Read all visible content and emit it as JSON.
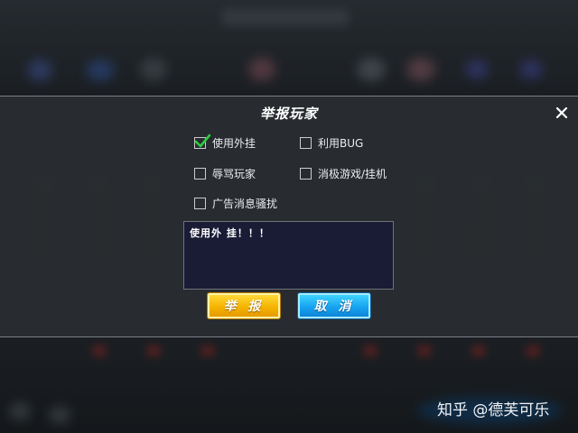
{
  "dialog": {
    "title": "举报玩家",
    "options": [
      {
        "label": "使用外挂",
        "checked": true
      },
      {
        "label": "利用BUG",
        "checked": false
      },
      {
        "label": "辱骂玩家",
        "checked": false
      },
      {
        "label": "消极游戏/挂机",
        "checked": false
      },
      {
        "label": "广告消息骚扰",
        "checked": false
      }
    ],
    "comment_text": "使用外 挂！！！",
    "report_button": "举 报",
    "cancel_button": "取 消"
  },
  "watermark": "知乎 @德芙可乐",
  "colors": {
    "check_mark": "#2ecc40",
    "report_button": "#f5b400",
    "cancel_button": "#17a4f0",
    "textarea_bg": "#1a1c36"
  },
  "icons": [
    "close-icon",
    "checkmark-icon"
  ]
}
